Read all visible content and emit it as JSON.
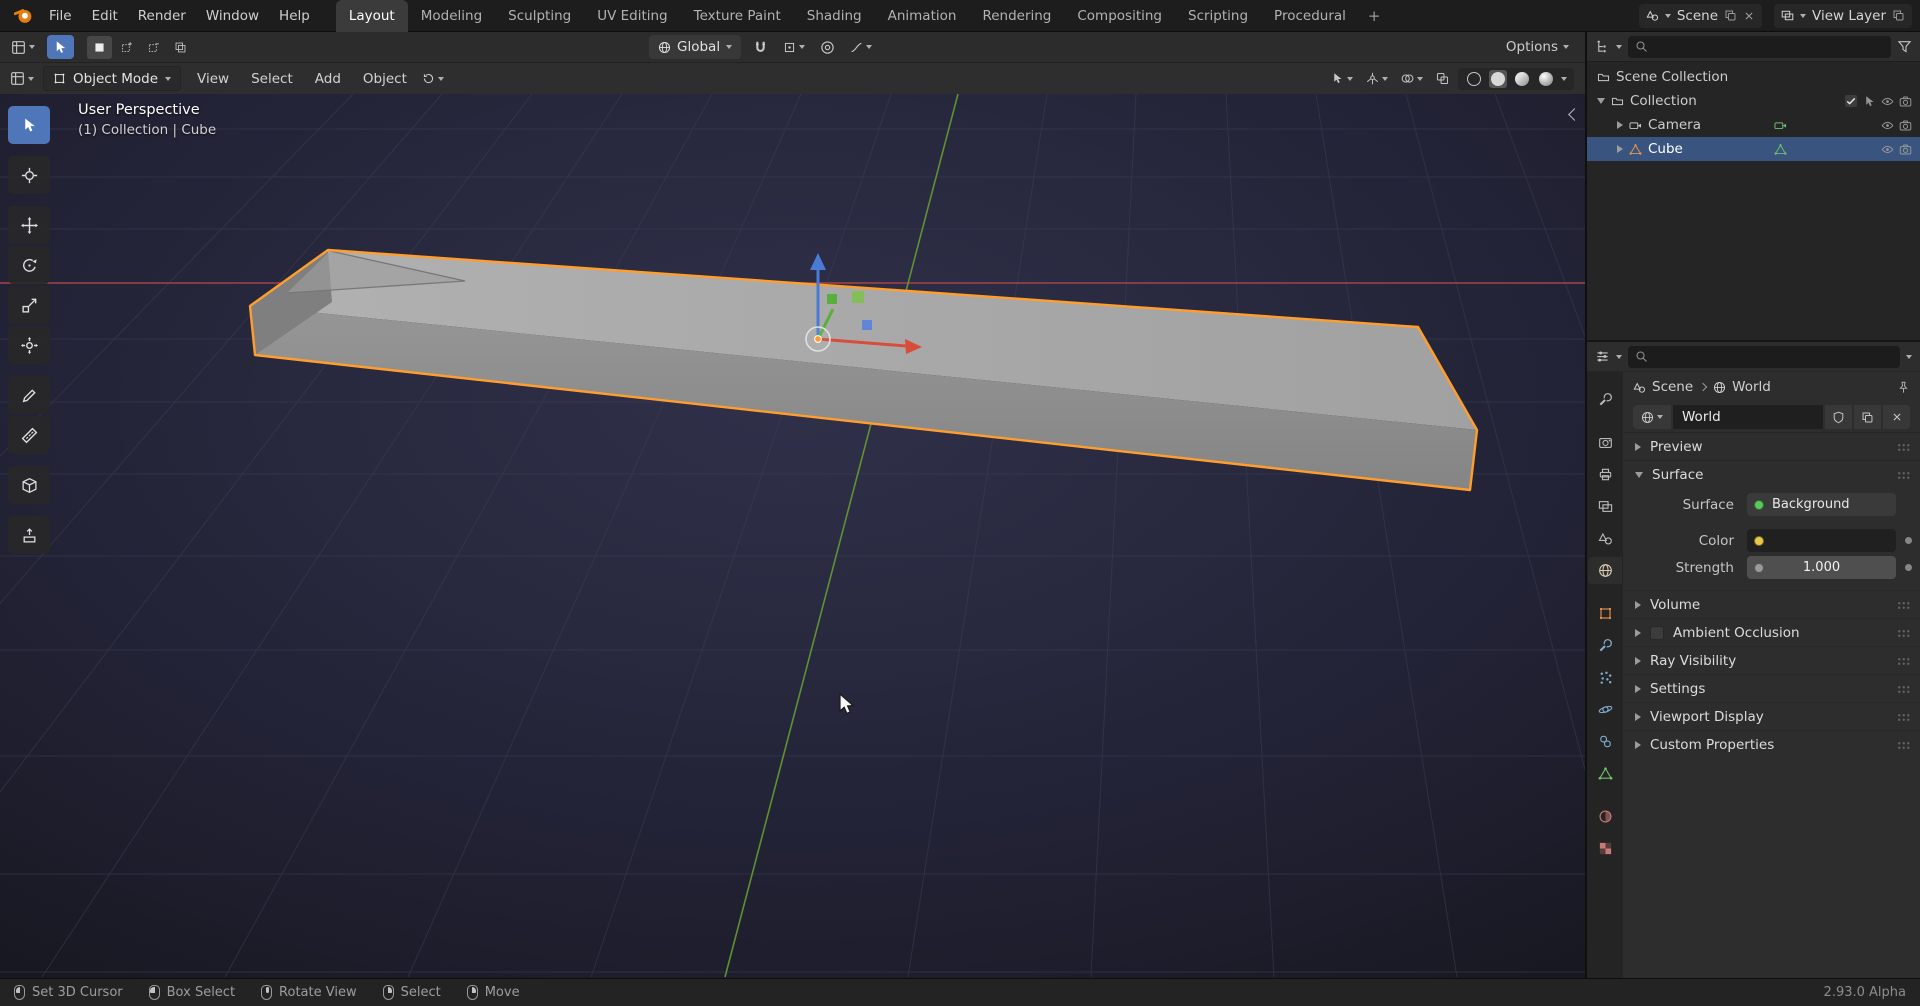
{
  "colors": {
    "accent_orange": "#e87d0d",
    "selection_outline": "#ff9e2c",
    "active_tool_blue": "#4f76b8",
    "selected_row_blue": "#39557f",
    "axis_x": "#c24848",
    "axis_y": "#649e30",
    "axis_z": "#4a7bd4",
    "socket_shader": "#58c858",
    "socket_color": "#e8c74a",
    "socket_value": "#9a9a9a"
  },
  "topbar": {
    "menus": [
      "File",
      "Edit",
      "Render",
      "Window",
      "Help"
    ],
    "tabs": [
      "Layout",
      "Modeling",
      "Sculpting",
      "UV Editing",
      "Texture Paint",
      "Shading",
      "Animation",
      "Rendering",
      "Compositing",
      "Scripting",
      "Procedural"
    ],
    "active_tab": "Layout",
    "add_tab": "+",
    "scene_label": "Scene",
    "view_layer_label": "View Layer"
  },
  "tool_settings": {
    "orientation": "Global",
    "options_label": "Options"
  },
  "viewport": {
    "mode": "Object Mode",
    "menus": [
      "View",
      "Select",
      "Add",
      "Object"
    ],
    "overlay": {
      "line1": "User Perspective",
      "line2": "(1) Collection | Cube"
    }
  },
  "outliner": {
    "scene_collection": "Scene Collection",
    "collection": "Collection",
    "camera": "Camera",
    "cube": "Cube"
  },
  "properties": {
    "breadcrumb": {
      "scene": "Scene",
      "world": "World"
    },
    "datablock_name": "World",
    "panels": {
      "preview": "Preview",
      "surface": "Surface",
      "volume": "Volume",
      "ambient_occlusion": "Ambient Occlusion",
      "ray_visibility": "Ray Visibility",
      "settings": "Settings",
      "viewport_display": "Viewport Display",
      "custom_properties": "Custom Properties"
    },
    "surface": {
      "surface_label": "Surface",
      "surface_value": "Background",
      "color_label": "Color",
      "strength_label": "Strength",
      "strength_value": "1.000"
    }
  },
  "statusbar": {
    "items": [
      "Set 3D Cursor",
      "Box Select",
      "Rotate View",
      "Select",
      "Move"
    ],
    "version": "2.93.0 Alpha"
  }
}
